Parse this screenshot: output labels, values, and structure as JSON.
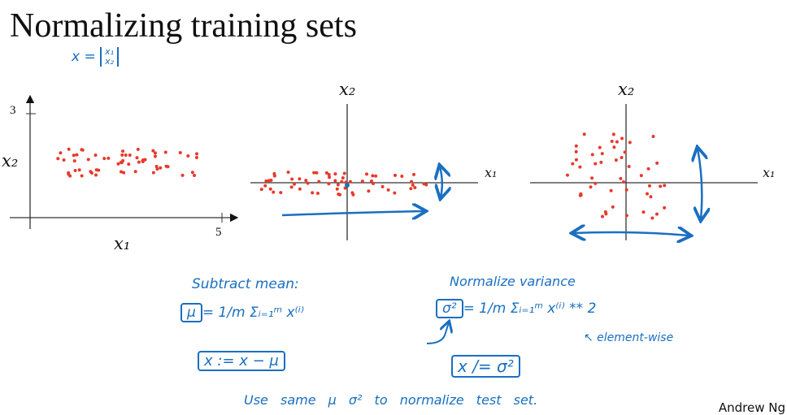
{
  "slide": {
    "title": "Normalizing training sets",
    "author": "Andrew Ng",
    "accent_color": "#1a6fc0",
    "point_color": "#e8392b"
  },
  "vector_note": {
    "lhs": "x =",
    "rows": [
      "x₁",
      "x₂"
    ]
  },
  "plots": [
    {
      "xlabel": "x₁",
      "ylabel": "x₂",
      "x_tick": "5",
      "y_tick": "3",
      "description_state": "raw"
    },
    {
      "xlabel": "x₁",
      "ylabel": "x₂",
      "description_state": "mean-subtracted"
    },
    {
      "xlabel": "x₁",
      "ylabel": "x₂",
      "description_state": "variance-normalized"
    }
  ],
  "notes": {
    "subtract_mean_heading": "Subtract mean:",
    "mu_formula_lhs": "μ",
    "mu_formula_rhs": "= 1/m Σᵢ₌₁ᵐ x⁽ⁱ⁾",
    "mu_update": "x := x − μ",
    "normalize_heading": "Normalize variance",
    "sigma_formula_lhs": "σ²",
    "sigma_formula_rhs": "= 1/m Σᵢ₌₁ᵐ x⁽ⁱ⁾ ** 2",
    "elementwise": "↖ element-wise",
    "sigma_update": "x /= σ²",
    "test_set": "Use same μ σ² to normalize test set."
  }
}
